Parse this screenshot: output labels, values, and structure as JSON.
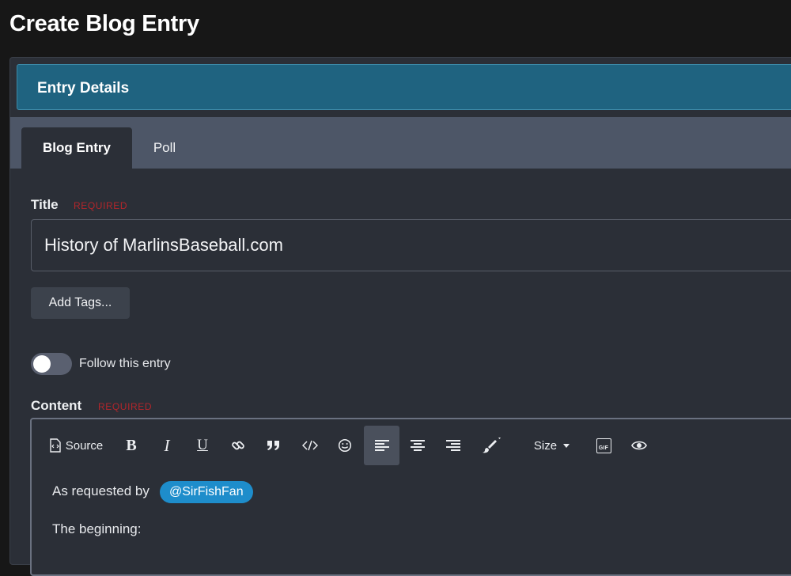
{
  "page": {
    "title": "Create Blog Entry"
  },
  "details": {
    "title": "Entry Details"
  },
  "tabs": [
    {
      "label": "Blog Entry",
      "active": true
    },
    {
      "label": "Poll",
      "active": false
    }
  ],
  "form": {
    "title_label": "Title",
    "required_label": "REQUIRED",
    "title_value": "History of MarlinsBaseball.com",
    "add_tags_label": "Add Tags...",
    "follow_label": "Follow this entry",
    "follow_on": false,
    "content_label": "Content"
  },
  "toolbar": {
    "source_label": "Source",
    "bold_glyph": "B",
    "italic_glyph": "I",
    "underline_glyph": "U",
    "size_label": "Size",
    "gif_label": "GIF",
    "icons": [
      "source-icon",
      "bold-icon",
      "italic-icon",
      "underline-icon",
      "link-icon",
      "quote-icon",
      "code-icon",
      "emoji-icon",
      "align-left-icon",
      "align-center-icon",
      "align-right-icon",
      "paint-brush-icon",
      "gif-icon",
      "preview-eye-icon"
    ]
  },
  "editor": {
    "line1_text": "As requested by",
    "mention": "@SirFishFan",
    "line2_text": "The beginning:"
  },
  "colors": {
    "accent_bar": "#1f6380",
    "mention_bg": "#1e8dcb",
    "required": "#b3262b"
  }
}
